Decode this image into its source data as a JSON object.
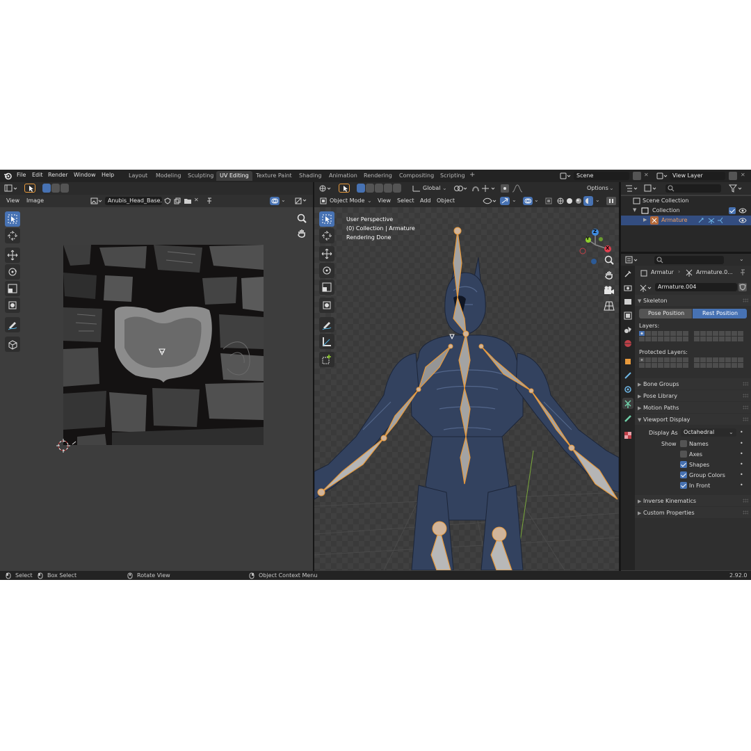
{
  "menu": {
    "items": [
      "File",
      "Edit",
      "Render",
      "Window",
      "Help"
    ],
    "workspaces": [
      "Layout",
      "Modeling",
      "Sculpting",
      "UV Editing",
      "Texture Paint",
      "Shading",
      "Animation",
      "Rendering",
      "Compositing",
      "Scripting"
    ],
    "active_workspace": "UV Editing",
    "add_tab": "+",
    "scene": "Scene",
    "view_layer": "View Layer"
  },
  "uv_editor": {
    "menus": [
      "View",
      "Image"
    ],
    "image_name": "Anubis_Head_Base..."
  },
  "viewport": {
    "transform_orientation": "Global",
    "options": "Options",
    "mode": "Object Mode",
    "menus": [
      "View",
      "Select",
      "Add",
      "Object"
    ],
    "overlay_lines": [
      "User Perspective",
      "(0) Collection | Armature",
      "Rendering Done"
    ],
    "gizmo_axes": {
      "z": "Z",
      "x": "X",
      "y": "Y"
    }
  },
  "outliner": {
    "root": "Scene Collection",
    "collection": "Collection",
    "object": "Armature"
  },
  "properties": {
    "object_name": "Armatur",
    "data_name": "Armature.0...",
    "armature_field": "Armature.004",
    "skeleton": {
      "title": "Skeleton",
      "pose_position": "Pose Position",
      "rest_position": "Rest Position",
      "layers_label": "Layers:",
      "protected_label": "Protected Layers:"
    },
    "collapsed_sections": [
      "Bone Groups",
      "Pose Library",
      "Motion Paths"
    ],
    "viewport_display": {
      "title": "Viewport Display",
      "display_as_label": "Display As",
      "display_as_value": "Octahedral",
      "show_label": "Show",
      "options": [
        {
          "label": "Names",
          "checked": false
        },
        {
          "label": "Axes",
          "checked": false
        },
        {
          "label": "Shapes",
          "checked": true
        },
        {
          "label": "Group Colors",
          "checked": true
        },
        {
          "label": "In Front",
          "checked": true
        }
      ]
    },
    "bottom_sections": [
      "Inverse Kinematics",
      "Custom Properties"
    ]
  },
  "statusbar": {
    "select": "Select",
    "box_select": "Box Select",
    "rotate_view": "Rotate View",
    "context_menu": "Object Context Menu",
    "version": "2.92.0"
  },
  "colors": {
    "accent": "#4772b3",
    "bone_fill": "#a3a3a3",
    "bone_outline": "#e89a3c",
    "character": "#3c4f7d",
    "axis_x": "#e0404f",
    "axis_y": "#8fcf2e",
    "axis_z": "#3f8ce0"
  }
}
